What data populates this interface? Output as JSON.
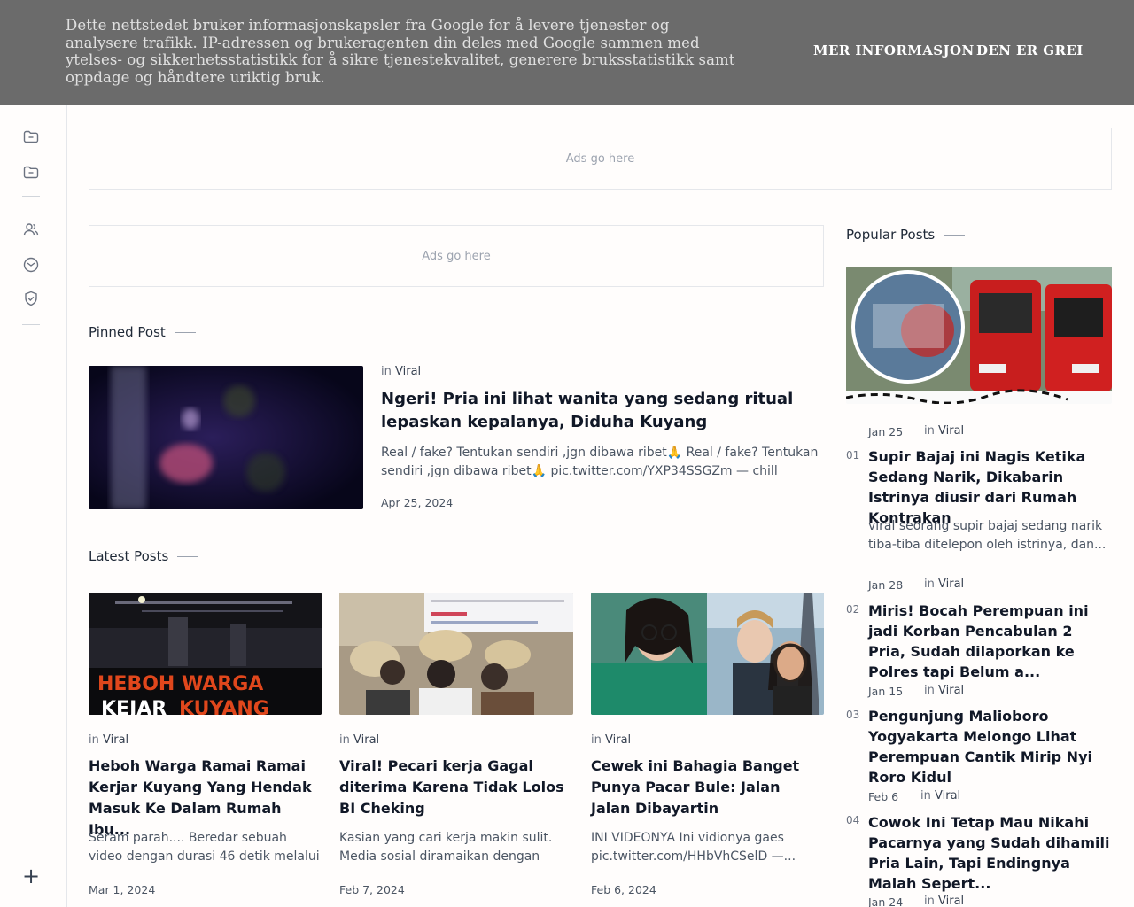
{
  "cookie": {
    "text": "Dette nettstedet bruker informasjonskapsler fra Google for å levere tjenester og analysere trafikk. IP-adressen og brukeragenten din deles med Google sammen med ytelses- og sikkerhetsstatistikk for å sikre tjenestekvalitet, generere bruksstatistikk samt oppdage og håndtere uriktig bruk.",
    "more_label": "MER INFORMASJON",
    "ok_label": "DEN ER GREI"
  },
  "sidebar": {
    "icons": [
      "folder-icon",
      "folder-icon",
      "users-icon",
      "mail-icon",
      "shield-check-icon"
    ],
    "add_label": "+"
  },
  "ads": {
    "label_top": "Ads go here",
    "label_main": "Ads go here"
  },
  "pinned": {
    "section_title": "Pinned Post",
    "in_label": "in",
    "category": "Viral",
    "title": "Ngeri! Pria ini lihat wanita yang sedang ritual lepaskan kepalanya, Diduha Kuyang",
    "excerpt": "Real / fake? Tentukan sendiri ,jgn dibawa ribet🙏 Real / fake? Tentukan sendiri ,jgn dibawa ribet🙏 pic.twitter.com/YXP34SSGZm — chill (@chillma...",
    "date": "Apr 25, 2024"
  },
  "latest": {
    "section_title": "Latest Posts",
    "posts": [
      {
        "in_label": "in",
        "category": "Viral",
        "title": "Heboh Warga Ramai Ramai Kerjar Kuyang Yang Hendak Masuk Ke Dalam Rumah Ibu...",
        "excerpt": "Seram parah.... Beredar sebuah video dengan durasi 46 detik melalui pesan...",
        "date": "Mar 1, 2024",
        "image_text_1": "HEBOH WARGA",
        "image_text_2a": "KEJAR",
        "image_text_2b": "KUYANG"
      },
      {
        "in_label": "in",
        "category": "Viral",
        "title": "Viral! Pecari kerja Gagal diterima Karena Tidak Lolos BI Cheking",
        "excerpt": "Kasian yang cari kerja makin sulit. Media sosial diramaikan dengan kaba...",
        "date": "Feb 7, 2024"
      },
      {
        "in_label": "in",
        "category": "Viral",
        "title": "Cewek ini Bahagia Banget Punya Pacar Bule: Jalan Jalan Dibayartin",
        "excerpt": "INI VIDEONYA Ini vidionya gaes pic.twitter.com/HHbVhCSelD —...",
        "date": "Feb 6, 2024"
      }
    ]
  },
  "popular": {
    "section_title": "Popular Posts",
    "posts": [
      {
        "num": "01",
        "date": "Jan 25",
        "in_label": "in",
        "category": "Viral",
        "title": "Supir Bajaj ini Nagis Ketika Sedang Narik, Dikabarin Istrinya diusir dari Rumah Kontrakan",
        "excerpt": "viral seorang supir bajaj sedang narik tiba-tiba ditelepon oleh istrinya, dan..."
      },
      {
        "num": "02",
        "date": "Jan 28",
        "in_label": "in",
        "category": "Viral",
        "title": "Miris! Bocah Perempuan ini jadi Korban Pencabulan 2 Pria, Sudah dilaporkan ke Polres tapi Belum a..."
      },
      {
        "num": "03",
        "date": "Jan 15",
        "in_label": "in",
        "category": "Viral",
        "title": "Pengunjung Malioboro Yogyakarta Melongo Lihat Perempuan Cantik Mirip Nyi Roro Kidul"
      },
      {
        "num": "04",
        "date": "Feb 6",
        "in_label": "in",
        "category": "Viral",
        "title": "Cowok Ini Tetap Mau Nikahi Pacarnya yang Sudah dihamili Pria Lain, Tapi Endingnya Malah Sepert..."
      },
      {
        "num": "",
        "date": "Jan 24",
        "in_label": "in",
        "category": "Viral",
        "title": ""
      }
    ]
  }
}
